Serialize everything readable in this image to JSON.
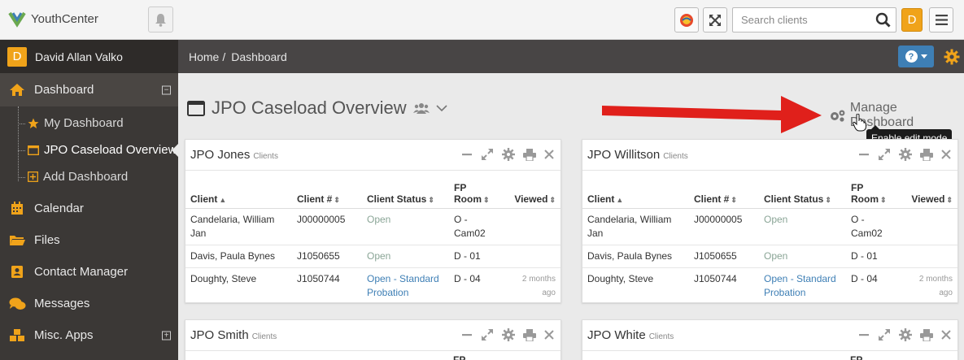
{
  "app": {
    "name": "YouthCenter"
  },
  "search": {
    "placeholder": "Search clients"
  },
  "user": {
    "initial": "D",
    "name": "David Allan Valko"
  },
  "sidebar": {
    "items": [
      {
        "label": "Dashboard",
        "icon": "home-icon"
      },
      {
        "label": "Calendar",
        "icon": "calendar-icon"
      },
      {
        "label": "Files",
        "icon": "folder-icon"
      },
      {
        "label": "Contact Manager",
        "icon": "contact-icon"
      },
      {
        "label": "Messages",
        "icon": "chat-icon"
      },
      {
        "label": "Misc. Apps",
        "icon": "cubes-icon"
      }
    ],
    "dashboard_sub": [
      {
        "label": "My Dashboard",
        "icon": "star-icon"
      },
      {
        "label": "JPO Caseload Overview",
        "icon": "window-icon"
      },
      {
        "label": "Add Dashboard",
        "icon": "plus-square-icon"
      }
    ]
  },
  "breadcrumb": {
    "home": "Home",
    "separator": "/",
    "current": "Dashboard"
  },
  "dashboard": {
    "title": "JPO Caseload Overview",
    "manage_label": "Manage Dashboard",
    "tooltip": "Enable edit mode"
  },
  "table_headers": {
    "client": "Client",
    "client_num": "Client #",
    "status": "Client Status",
    "room_1": "FP",
    "room_2": "Room",
    "viewed": "Viewed"
  },
  "widgets": [
    {
      "title": "JPO Jones",
      "subtitle": "Clients",
      "rows": [
        {
          "client_1": "Candelaria, William",
          "client_2": "Jan",
          "num": "J00000005",
          "status": "Open",
          "status_2": "",
          "room_1": "O -",
          "room_2": "Cam02",
          "viewed": ""
        },
        {
          "client_1": "Davis, Paula Bynes",
          "client_2": "",
          "num": "J1050655",
          "status": "Open",
          "status_2": "",
          "room_1": "D - 01",
          "room_2": "",
          "viewed": ""
        },
        {
          "client_1": "Doughty, Steve",
          "client_2": "",
          "num": "J1050744",
          "status": "Open - Standard",
          "status_2": "Probation",
          "room_1": "D - 04",
          "room_2": "",
          "viewed": "2 months ago"
        }
      ]
    },
    {
      "title": "JPO Willitson",
      "subtitle": "Clients",
      "rows": [
        {
          "client_1": "Candelaria, William",
          "client_2": "Jan",
          "num": "J00000005",
          "status": "Open",
          "status_2": "",
          "room_1": "O -",
          "room_2": "Cam02",
          "viewed": ""
        },
        {
          "client_1": "Davis, Paula Bynes",
          "client_2": "",
          "num": "J1050655",
          "status": "Open",
          "status_2": "",
          "room_1": "D - 01",
          "room_2": "",
          "viewed": ""
        },
        {
          "client_1": "Doughty, Steve",
          "client_2": "",
          "num": "J1050744",
          "status": "Open - Standard",
          "status_2": "Probation",
          "room_1": "D - 04",
          "room_2": "",
          "viewed": "2 months ago"
        }
      ]
    },
    {
      "title": "JPO Smith",
      "subtitle": "Clients"
    },
    {
      "title": "JPO White",
      "subtitle": "Clients"
    }
  ],
  "colors": {
    "accent": "#f0a31a",
    "sidebar_bg": "#3b3836",
    "crumbbar_bg": "#484545",
    "link": "#3e7fb5",
    "status_open": "#8aa596",
    "annotation_arrow": "#e0201b"
  }
}
